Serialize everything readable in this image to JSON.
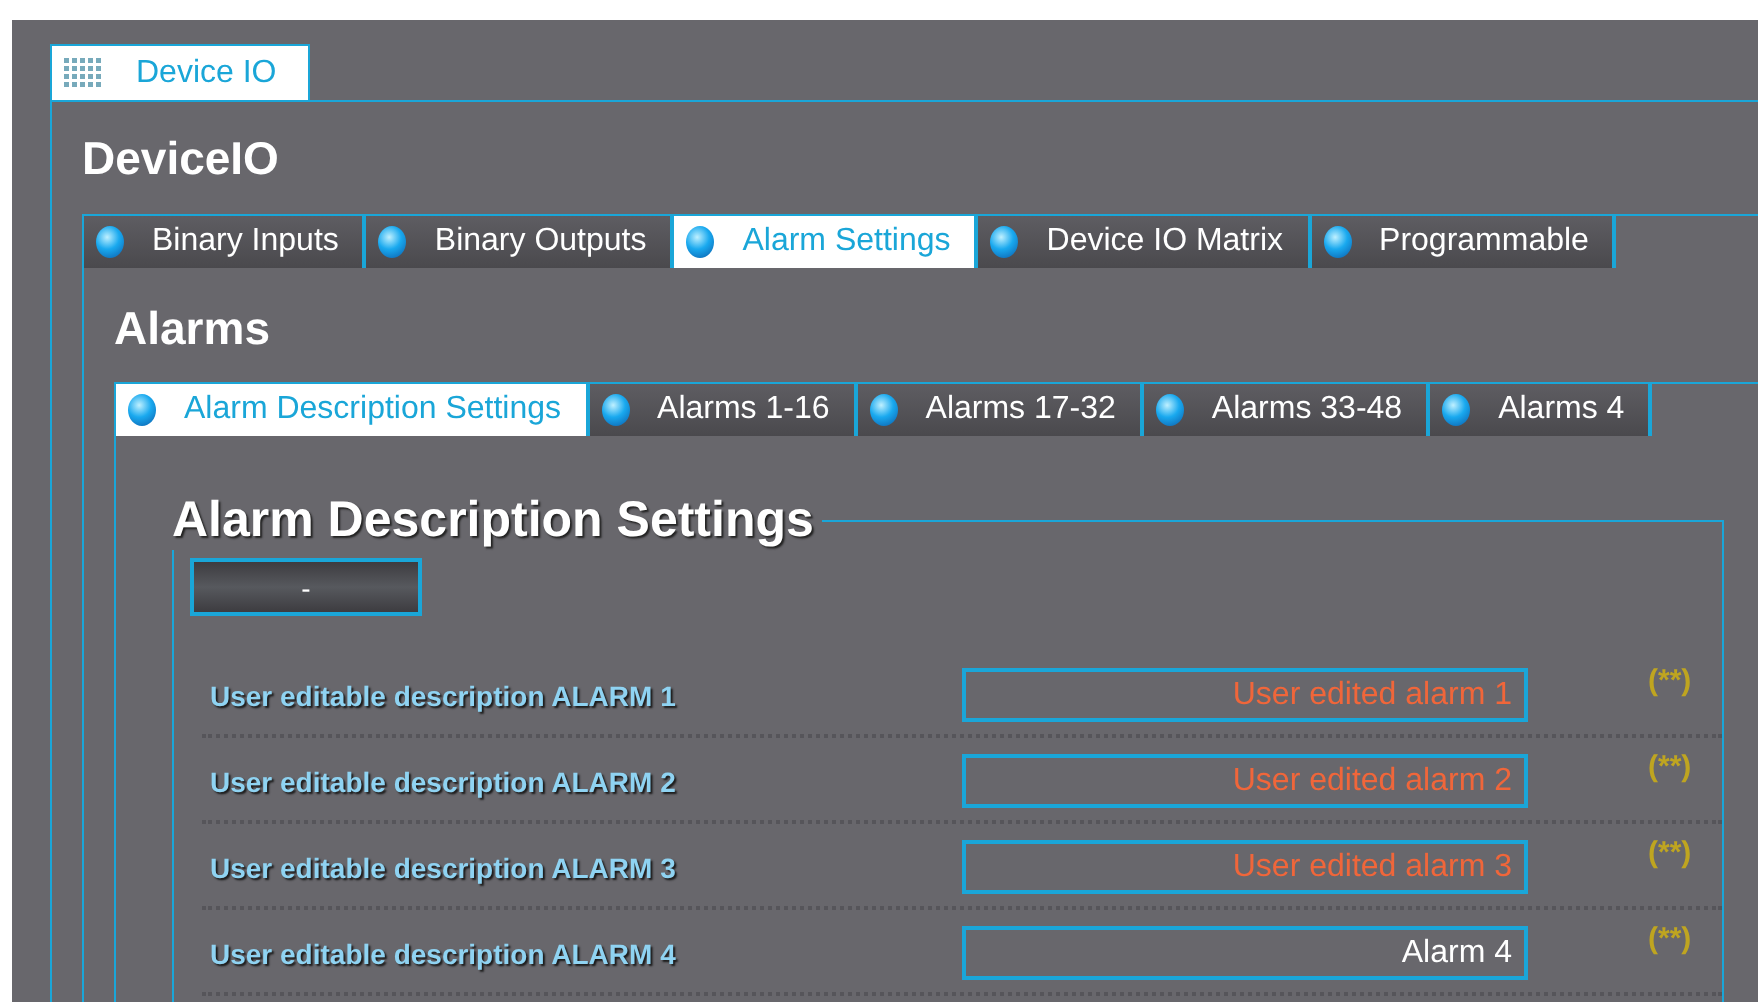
{
  "top_tab": {
    "label": "Device IO",
    "selected": true
  },
  "title": "DeviceIO",
  "tabs": [
    {
      "label": "Binary Inputs",
      "selected": false
    },
    {
      "label": "Binary Outputs",
      "selected": false
    },
    {
      "label": "Alarm Settings",
      "selected": true
    },
    {
      "label": "Device IO Matrix",
      "selected": false
    },
    {
      "label": "Programmable",
      "selected": false
    }
  ],
  "section_title": "Alarms",
  "subtabs": [
    {
      "label": "Alarm Description Settings",
      "selected": true
    },
    {
      "label": "Alarms 1-16",
      "selected": false
    },
    {
      "label": "Alarms 17-32",
      "selected": false
    },
    {
      "label": "Alarms 33-48",
      "selected": false
    },
    {
      "label": "Alarms 4",
      "selected": false
    }
  ],
  "group": {
    "title": "Alarm Description Settings",
    "button": "-",
    "rows": [
      {
        "label": "User editable description ALARM 1",
        "value": "User edited alarm 1",
        "edited": true,
        "marker": "(**)"
      },
      {
        "label": "User editable description ALARM 2",
        "value": "User edited alarm 2",
        "edited": true,
        "marker": "(**)"
      },
      {
        "label": "User editable description ALARM 3",
        "value": "User edited alarm 3",
        "edited": true,
        "marker": "(**)"
      },
      {
        "label": "User editable description ALARM 4",
        "value": "Alarm 4",
        "edited": false,
        "marker": "(**)"
      }
    ]
  }
}
